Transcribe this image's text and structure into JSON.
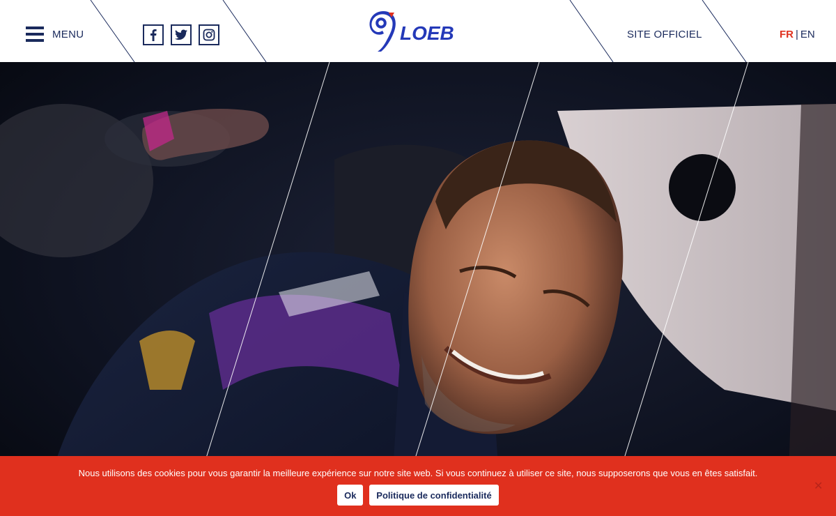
{
  "header": {
    "menu_label": "MENU",
    "site_officiel": "SITE OFFICIEL",
    "lang_fr": "FR",
    "lang_separator": "|",
    "lang_en": "EN",
    "logo_text": "LOEB",
    "socials": [
      "facebook-icon",
      "twitter-icon",
      "instagram-icon"
    ]
  },
  "cookie": {
    "message": "Nous utilisons des cookies pour vous garantir la meilleure expérience sur notre site web. Si vous continuez à utiliser ce site, nous supposerons que vous en êtes satisfait.",
    "ok_label": "Ok",
    "privacy_label": "Politique de confidentialité",
    "close_label": "✕"
  },
  "colors": {
    "navy": "#1a2a5c",
    "accent_red": "#e0301e",
    "logo_blue": "#2439b8"
  }
}
